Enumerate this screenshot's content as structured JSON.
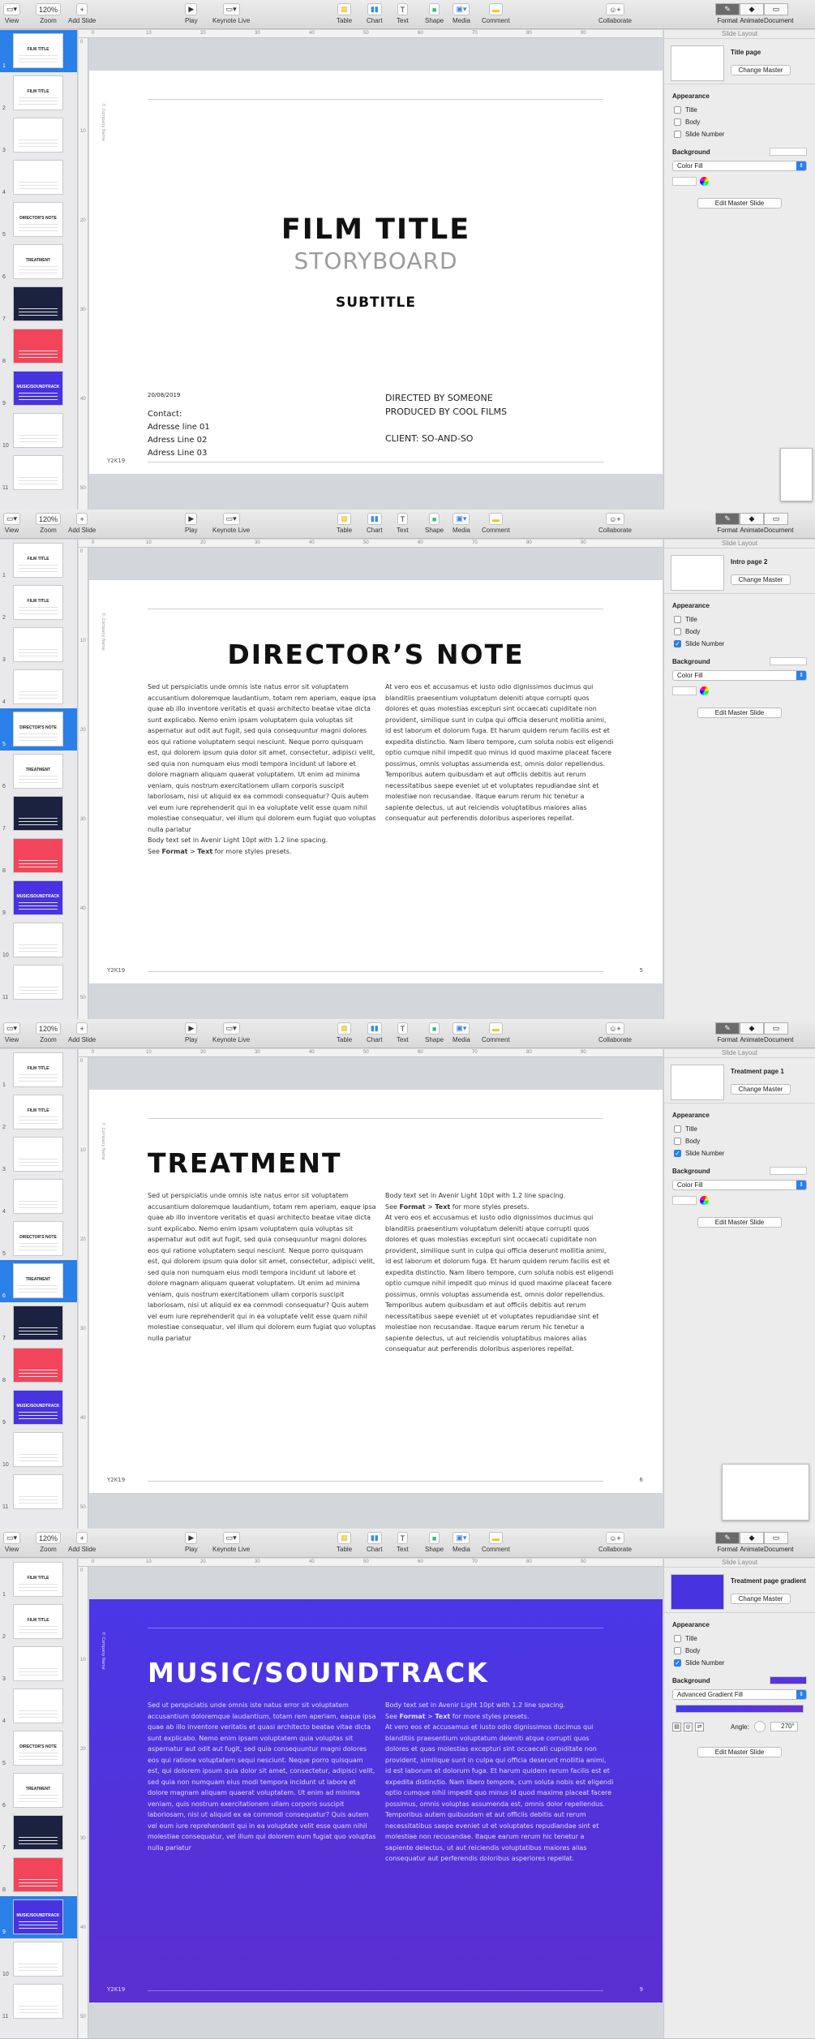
{
  "toolbar": {
    "view": "View",
    "zoom_value": "120%",
    "zoom": "Zoom",
    "add_slide": "Add Slide",
    "play": "Play",
    "keynote_live": "Keynote Live",
    "table": "Table",
    "chart": "Chart",
    "text": "Text",
    "shape": "Shape",
    "media": "Media",
    "comment": "Comment",
    "collaborate": "Collaborate",
    "format": "Format",
    "animate": "Animate",
    "document": "Document"
  },
  "ruler": {
    "top": [
      "0",
      "10",
      "20",
      "30",
      "40",
      "50",
      "60",
      "70",
      "80",
      "90"
    ],
    "left": [
      "0",
      "10",
      "20",
      "30",
      "40",
      "50"
    ]
  },
  "navigator": {
    "slides": [
      {
        "num": "1",
        "title": "FILM TITLE",
        "style": "white"
      },
      {
        "num": "2",
        "title": "FILM TITLE",
        "style": "white"
      },
      {
        "num": "3",
        "title": "",
        "style": "white"
      },
      {
        "num": "4",
        "title": "",
        "style": "white"
      },
      {
        "num": "5",
        "title": "DIRECTOR'S NOTE",
        "style": "white"
      },
      {
        "num": "6",
        "title": "TREATMENT",
        "style": "white"
      },
      {
        "num": "7",
        "title": "",
        "style": "dark"
      },
      {
        "num": "8",
        "title": "",
        "style": "red"
      },
      {
        "num": "9",
        "title": "MUSIC/SOUNDTRACK",
        "style": "purple"
      },
      {
        "num": "10",
        "title": "",
        "style": "white"
      },
      {
        "num": "11",
        "title": "",
        "style": "white"
      }
    ]
  },
  "common": {
    "company_name": "© Company Name",
    "footer_left": "Y2K19",
    "lorem_left": "Sed ut perspiciatis unde omnis iste natus error sit voluptatem accusantium doloremque laudantium, totam rem aperiam, eaque ipsa quae ab illo inventore veritatis et quasi architecto beatae vitae dicta sunt explicabo. Nemo enim ipsam voluptatem quia voluptas sit aspernatur aut odit aut fugit, sed quia consequuntur magni dolores eos qui ratione voluptatem sequi nesciunt. Neque porro quisquam est, qui dolorem ipsum quia dolor sit amet, consectetur, adipisci velit, sed quia non numquam eius modi tempora incidunt ut labore et dolore magnam aliquam quaerat voluptatem. Ut enim ad minima veniam, quis nostrum exercitationem ullam corporis suscipit laboriosam, nisi ut aliquid ex ea commodi consequatur? Quis autem vel eum iure reprehenderit qui in ea voluptate velit esse quam nihil molestiae consequatur, vel illum qui dolorem eum fugiat quo voluptas nulla pariatur",
    "lorem_right": "At vero eos et accusamus et iusto odio dignissimos ducimus qui blanditiis praesentium voluptatum deleniti atque corrupti quos dolores et quas molestias excepturi sint occaecati cupiditate non provident, similique sunt in culpa qui officia deserunt mollitia animi, id est laborum et dolorum fuga. Et harum quidem rerum facilis est et expedita distinctio. Nam libero tempore, cum soluta nobis est eligendi optio cumque nihil impedit quo minus id quod maxime placeat facere possimus, omnis voluptas assumenda est, omnis dolor repellendus. Temporibus autem quibusdam et aut officiis debitis aut rerum necessitatibus saepe eveniet ut et voluptates repudiandae sint et molestiae non recusandae. Itaque earum rerum hic tenetur a sapiente delectus, ut aut reiciendis voluptatibus maiores alias consequatur aut perferendis doloribus asperiores repellat.",
    "body_note": "Body text set in Avenir Light 10pt with 1.2 line spacing.",
    "see_prefix": "See ",
    "see_format": "Format",
    "see_gt": " > ",
    "see_text": "Text",
    "see_suffix": " for more styles presets."
  },
  "screens": [
    {
      "slide": {
        "title": "FILM TITLE",
        "storyboard": "STORYBOARD",
        "subtitle": "SUBTITLE",
        "date": "20/08/2019",
        "contact": "Contact:",
        "addr1": "Adresse line 01",
        "addr2": "Adress Line 02",
        "addr3": "Adress Line 03",
        "directed": "DIRECTED BY SOMEONE",
        "produced": "PRODUCED BY COOL FILMS",
        "client": "CLIENT: SO-AND-SO"
      },
      "inspector": {
        "header": "Slide Layout",
        "layout_name": "Title page",
        "change_master": "Change Master",
        "appearance": "Appearance",
        "title": "Title",
        "body": "Body",
        "slide_number": "Slide Number",
        "background": "Background",
        "fill": "Color Fill",
        "edit_master": "Edit Master Slide",
        "checks": {
          "title": false,
          "body": false,
          "slide_number": false
        }
      }
    },
    {
      "slide": {
        "title": "DIRECTOR’S NOTE",
        "page": "5"
      },
      "inspector": {
        "header": "Slide Layout",
        "layout_name": "Intro page 2",
        "change_master": "Change Master",
        "appearance": "Appearance",
        "title": "Title",
        "body": "Body",
        "slide_number": "Slide Number",
        "background": "Background",
        "fill": "Color Fill",
        "edit_master": "Edit Master Slide",
        "checks": {
          "title": false,
          "body": false,
          "slide_number": true
        }
      }
    },
    {
      "slide": {
        "title": "TREATMENT",
        "page": "6"
      },
      "inspector": {
        "header": "Slide Layout",
        "layout_name": "Treatment page 1",
        "change_master": "Change Master",
        "appearance": "Appearance",
        "title": "Title",
        "body": "Body",
        "slide_number": "Slide Number",
        "background": "Background",
        "fill": "Color Fill",
        "edit_master": "Edit Master Slide",
        "checks": {
          "title": false,
          "body": false,
          "slide_number": true
        }
      }
    },
    {
      "slide": {
        "title": "MUSIC/SOUNDTRACK",
        "page": "9"
      },
      "inspector": {
        "header": "Slide Layout",
        "layout_name": "Treatment page gradient",
        "change_master": "Change Master",
        "appearance": "Appearance",
        "title": "Title",
        "body": "Body",
        "slide_number": "Slide Number",
        "background": "Background",
        "fill": "Advanced Gradient Fill",
        "angle_label": "Angle:",
        "angle_value": "270°",
        "edit_master": "Edit Master Slide",
        "checks": {
          "title": false,
          "body": false,
          "slide_number": true
        }
      }
    }
  ],
  "colors": {
    "selection": "#2a7fe8",
    "gradient_start": "#4937e6",
    "gradient_end": "#5a2fd0"
  }
}
